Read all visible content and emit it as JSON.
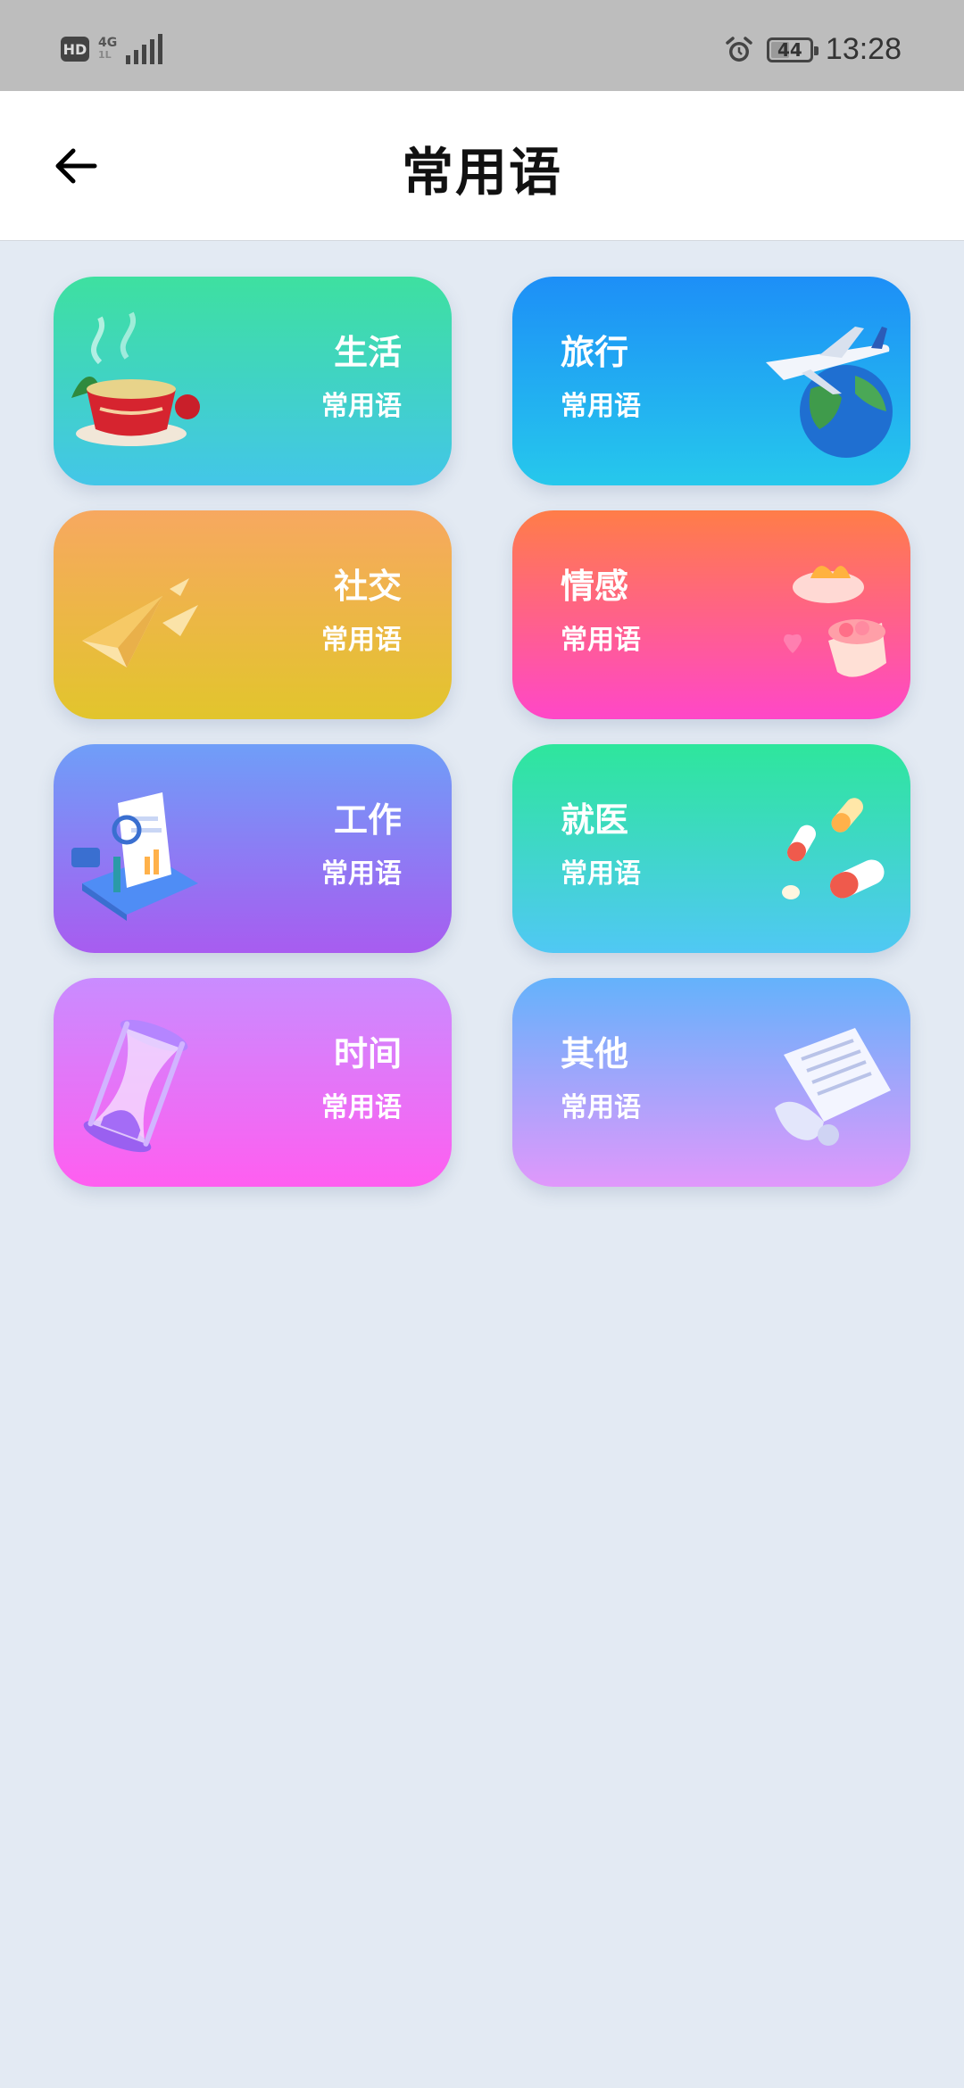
{
  "status_bar": {
    "hd": "HD",
    "network": "4G",
    "network_sub": "1L",
    "battery": "44",
    "time": "13:28"
  },
  "header": {
    "title": "常用语",
    "back_icon": "arrow-left-icon"
  },
  "categories": [
    {
      "title": "生活",
      "subtitle": "常用语",
      "icon": "tea-cup-icon",
      "gradient": [
        "#3ee0a0",
        "#43c6e8"
      ]
    },
    {
      "title": "旅行",
      "subtitle": "常用语",
      "icon": "airplane-globe-icon",
      "gradient": [
        "#1d8ff7",
        "#26c8ec"
      ]
    },
    {
      "title": "社交",
      "subtitle": "常用语",
      "icon": "paper-plane-icon",
      "gradient": [
        "#f7a860",
        "#e2c52c"
      ]
    },
    {
      "title": "情感",
      "subtitle": "常用语",
      "icon": "gift-box-icon",
      "gradient": [
        "#ff7d48",
        "#ff47c8"
      ]
    },
    {
      "title": "工作",
      "subtitle": "常用语",
      "icon": "document-search-icon",
      "gradient": [
        "#6f9ef8",
        "#a85cf0"
      ]
    },
    {
      "title": "就医",
      "subtitle": "常用语",
      "icon": "pills-icon",
      "gradient": [
        "#2ee69c",
        "#50c8f4"
      ]
    },
    {
      "title": "时间",
      "subtitle": "常用语",
      "icon": "hourglass-icon",
      "gradient": [
        "#c98cff",
        "#ff5ef0"
      ]
    },
    {
      "title": "其他",
      "subtitle": "常用语",
      "icon": "paper-scroll-icon",
      "gradient": [
        "#64b2fb",
        "#e098fb"
      ]
    }
  ]
}
